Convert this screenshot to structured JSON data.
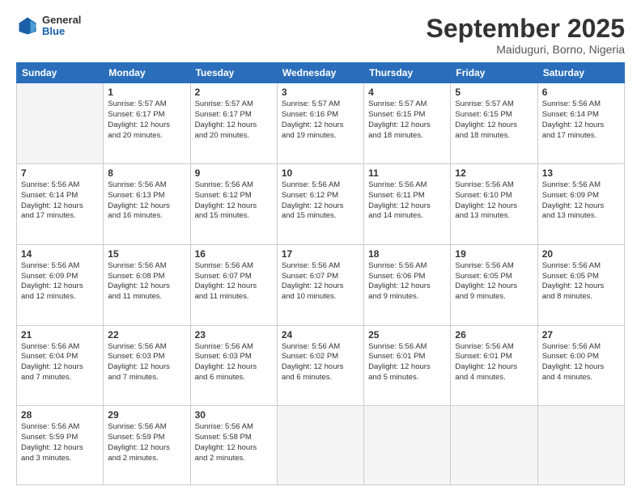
{
  "header": {
    "logo": {
      "general": "General",
      "blue": "Blue"
    },
    "title": "September 2025",
    "location": "Maiduguri, Borno, Nigeria"
  },
  "days_of_week": [
    "Sunday",
    "Monday",
    "Tuesday",
    "Wednesday",
    "Thursday",
    "Friday",
    "Saturday"
  ],
  "weeks": [
    [
      {
        "day": "",
        "empty": true
      },
      {
        "day": "1",
        "sunrise": "5:57 AM",
        "sunset": "6:17 PM",
        "daylight": "12 hours and 20 minutes."
      },
      {
        "day": "2",
        "sunrise": "5:57 AM",
        "sunset": "6:17 PM",
        "daylight": "12 hours and 20 minutes."
      },
      {
        "day": "3",
        "sunrise": "5:57 AM",
        "sunset": "6:16 PM",
        "daylight": "12 hours and 19 minutes."
      },
      {
        "day": "4",
        "sunrise": "5:57 AM",
        "sunset": "6:15 PM",
        "daylight": "12 hours and 18 minutes."
      },
      {
        "day": "5",
        "sunrise": "5:57 AM",
        "sunset": "6:15 PM",
        "daylight": "12 hours and 18 minutes."
      },
      {
        "day": "6",
        "sunrise": "5:56 AM",
        "sunset": "6:14 PM",
        "daylight": "12 hours and 17 minutes."
      }
    ],
    [
      {
        "day": "7",
        "sunrise": "5:56 AM",
        "sunset": "6:14 PM",
        "daylight": "12 hours and 17 minutes."
      },
      {
        "day": "8",
        "sunrise": "5:56 AM",
        "sunset": "6:13 PM",
        "daylight": "12 hours and 16 minutes."
      },
      {
        "day": "9",
        "sunrise": "5:56 AM",
        "sunset": "6:12 PM",
        "daylight": "12 hours and 15 minutes."
      },
      {
        "day": "10",
        "sunrise": "5:56 AM",
        "sunset": "6:12 PM",
        "daylight": "12 hours and 15 minutes."
      },
      {
        "day": "11",
        "sunrise": "5:56 AM",
        "sunset": "6:11 PM",
        "daylight": "12 hours and 14 minutes."
      },
      {
        "day": "12",
        "sunrise": "5:56 AM",
        "sunset": "6:10 PM",
        "daylight": "12 hours and 13 minutes."
      },
      {
        "day": "13",
        "sunrise": "5:56 AM",
        "sunset": "6:09 PM",
        "daylight": "12 hours and 13 minutes."
      }
    ],
    [
      {
        "day": "14",
        "sunrise": "5:56 AM",
        "sunset": "6:09 PM",
        "daylight": "12 hours and 12 minutes."
      },
      {
        "day": "15",
        "sunrise": "5:56 AM",
        "sunset": "6:08 PM",
        "daylight": "12 hours and 11 minutes."
      },
      {
        "day": "16",
        "sunrise": "5:56 AM",
        "sunset": "6:07 PM",
        "daylight": "12 hours and 11 minutes."
      },
      {
        "day": "17",
        "sunrise": "5:56 AM",
        "sunset": "6:07 PM",
        "daylight": "12 hours and 10 minutes."
      },
      {
        "day": "18",
        "sunrise": "5:56 AM",
        "sunset": "6:06 PM",
        "daylight": "12 hours and 9 minutes."
      },
      {
        "day": "19",
        "sunrise": "5:56 AM",
        "sunset": "6:05 PM",
        "daylight": "12 hours and 9 minutes."
      },
      {
        "day": "20",
        "sunrise": "5:56 AM",
        "sunset": "6:05 PM",
        "daylight": "12 hours and 8 minutes."
      }
    ],
    [
      {
        "day": "21",
        "sunrise": "5:56 AM",
        "sunset": "6:04 PM",
        "daylight": "12 hours and 7 minutes."
      },
      {
        "day": "22",
        "sunrise": "5:56 AM",
        "sunset": "6:03 PM",
        "daylight": "12 hours and 7 minutes."
      },
      {
        "day": "23",
        "sunrise": "5:56 AM",
        "sunset": "6:03 PM",
        "daylight": "12 hours and 6 minutes."
      },
      {
        "day": "24",
        "sunrise": "5:56 AM",
        "sunset": "6:02 PM",
        "daylight": "12 hours and 6 minutes."
      },
      {
        "day": "25",
        "sunrise": "5:56 AM",
        "sunset": "6:01 PM",
        "daylight": "12 hours and 5 minutes."
      },
      {
        "day": "26",
        "sunrise": "5:56 AM",
        "sunset": "6:01 PM",
        "daylight": "12 hours and 4 minutes."
      },
      {
        "day": "27",
        "sunrise": "5:56 AM",
        "sunset": "6:00 PM",
        "daylight": "12 hours and 4 minutes."
      }
    ],
    [
      {
        "day": "28",
        "sunrise": "5:56 AM",
        "sunset": "5:59 PM",
        "daylight": "12 hours and 3 minutes."
      },
      {
        "day": "29",
        "sunrise": "5:56 AM",
        "sunset": "5:59 PM",
        "daylight": "12 hours and 2 minutes."
      },
      {
        "day": "30",
        "sunrise": "5:56 AM",
        "sunset": "5:58 PM",
        "daylight": "12 hours and 2 minutes."
      },
      {
        "day": "",
        "empty": true
      },
      {
        "day": "",
        "empty": true
      },
      {
        "day": "",
        "empty": true
      },
      {
        "day": "",
        "empty": true
      }
    ]
  ]
}
